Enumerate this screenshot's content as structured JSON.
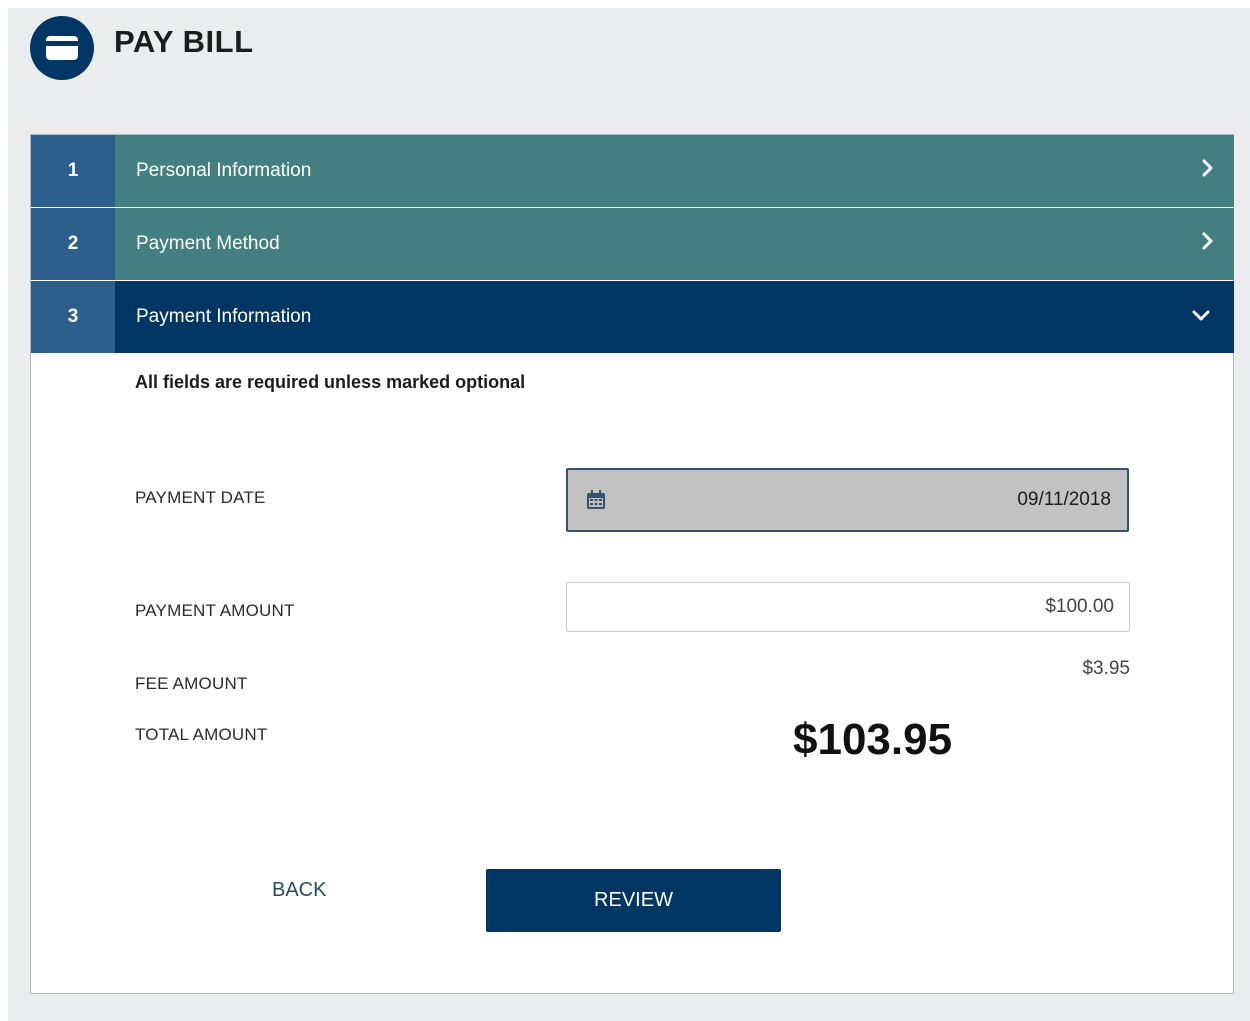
{
  "header": {
    "title": "PAY BILL",
    "icon": "credit-card-icon"
  },
  "steps": [
    {
      "number": "1",
      "label": "Personal Information",
      "state": "collapsed"
    },
    {
      "number": "2",
      "label": "Payment Method",
      "state": "collapsed"
    },
    {
      "number": "3",
      "label": "Payment Information",
      "state": "expanded"
    }
  ],
  "form": {
    "note": "All fields are required unless marked optional",
    "payment_date_label": "PAYMENT DATE",
    "payment_date_value": "09/11/2018",
    "payment_amount_label": "PAYMENT AMOUNT",
    "payment_amount_value": "$100.00",
    "fee_amount_label": "FEE AMOUNT",
    "fee_amount_value": "$3.95",
    "total_amount_label": "TOTAL AMOUNT",
    "total_amount_value": "$103.95"
  },
  "actions": {
    "back_label": "BACK",
    "review_label": "REVIEW"
  },
  "colors": {
    "primary": "#003664",
    "step_number_bg": "#2e5f8c",
    "step_collapsed_bg": "#437f80",
    "page_bg": "#ebecee"
  }
}
